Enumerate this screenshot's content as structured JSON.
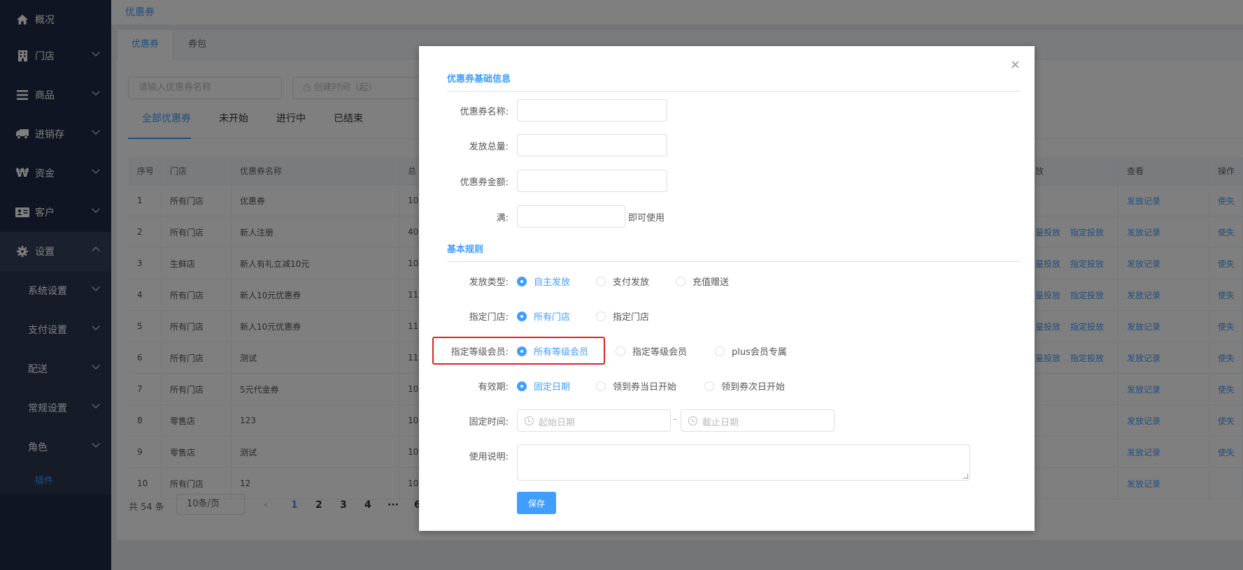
{
  "sidebar": {
    "items": [
      {
        "label": "概况",
        "icon": "home-icon"
      },
      {
        "label": "门店",
        "icon": "building-icon"
      },
      {
        "label": "商品",
        "icon": "list-icon"
      },
      {
        "label": "进销存",
        "icon": "truck-icon"
      },
      {
        "label": "资金",
        "icon": "won-icon"
      },
      {
        "label": "客户",
        "icon": "id-card-icon"
      },
      {
        "label": "设置",
        "icon": "gear-icon"
      }
    ],
    "sub_items": [
      "系统设置",
      "支付设置",
      "配送",
      "常规设置",
      "角色"
    ],
    "sub_sub_item": "插件"
  },
  "topbar": {
    "breadcrumb": "优惠券"
  },
  "background": {
    "tabs": [
      "优惠券",
      "券包"
    ],
    "filters": {
      "name_placeholder": "请输入优惠券名称",
      "date_placeholder": "创建时间（起）"
    },
    "status_tabs": [
      "全部优惠券",
      "未开始",
      "进行中",
      "已结束"
    ],
    "table": {
      "headers": [
        "序号",
        "门店",
        "优惠券名称",
        "总",
        "放",
        "查看",
        "操作"
      ],
      "rows": [
        {
          "no": "1",
          "store": "所有门店",
          "name": "优惠券",
          "total": "10",
          "dist": [
            "",
            ""
          ],
          "view": "发放记录",
          "op": "使失"
        },
        {
          "no": "2",
          "store": "所有门店",
          "name": "新人注册",
          "total": "40",
          "dist": [
            "量投放",
            "指定投放"
          ],
          "view": "发放记录",
          "op": "使失"
        },
        {
          "no": "3",
          "store": "生鲜店",
          "name": "新人有礼立减10元",
          "total": "10",
          "dist": [
            "量投放",
            "指定投放"
          ],
          "view": "发放记录",
          "op": "使失"
        },
        {
          "no": "4",
          "store": "所有门店",
          "name": "新人10元优惠券",
          "total": "11",
          "dist": [
            "量投放",
            "指定投放"
          ],
          "view": "发放记录",
          "op": "使失"
        },
        {
          "no": "5",
          "store": "所有门店",
          "name": "新人10元优惠券",
          "total": "11",
          "dist": [
            "量投放",
            "指定投放"
          ],
          "view": "发放记录",
          "op": "使失"
        },
        {
          "no": "6",
          "store": "所有门店",
          "name": "测试",
          "total": "11",
          "dist": [
            "量投放",
            "指定投放"
          ],
          "view": "发放记录",
          "op": "使失"
        },
        {
          "no": "7",
          "store": "所有门店",
          "name": "5元代金券",
          "total": "10",
          "dist": [
            "",
            ""
          ],
          "view": "发放记录",
          "op": "使失"
        },
        {
          "no": "8",
          "store": "零售店",
          "name": "123",
          "total": "10",
          "dist": [
            "",
            ""
          ],
          "view": "发放记录",
          "op": "使失"
        },
        {
          "no": "9",
          "store": "零售店",
          "name": "测试",
          "total": "10",
          "dist": [
            "",
            ""
          ],
          "view": "发放记录",
          "op": "使失"
        },
        {
          "no": "10",
          "store": "所有门店",
          "name": "12",
          "total": "10",
          "dist": [
            "",
            ""
          ],
          "view": "发放记录",
          "op": ""
        }
      ]
    },
    "pager": {
      "total": "共 54 条",
      "page_size": "10条/页",
      "pages": [
        "1",
        "2",
        "3",
        "4",
        "···",
        "6"
      ],
      "current": "1"
    }
  },
  "modal": {
    "close": "×",
    "section1": "优惠券基础信息",
    "name_label": "优惠券名称:",
    "qty_label": "发放总量:",
    "amount_label": "优惠券金额:",
    "min_label": "满:",
    "min_suffix": "即可使用",
    "section2": "基本规则",
    "issue_type": {
      "label": "发放类型:",
      "options": [
        "自主发放",
        "支付发放",
        "充值赠送"
      ],
      "selected": 0
    },
    "store": {
      "label": "指定门店:",
      "options": [
        "所有门店",
        "指定门店"
      ],
      "selected": 0
    },
    "member": {
      "label": "指定等级会员:",
      "options": [
        "所有等级会员",
        "指定等级会员",
        "plus会员专属"
      ],
      "selected": 0
    },
    "validity": {
      "label": "有效期:",
      "options": [
        "固定日期",
        "领到券当日开始",
        "领到券次日开始"
      ],
      "selected": 0
    },
    "fixed_time": {
      "label": "固定时间:",
      "start_placeholder": "起始日期",
      "separator": "-",
      "end_placeholder": "截止日期"
    },
    "desc_label": "使用说明:",
    "save": "保存"
  },
  "colors": {
    "accent": "#409eff",
    "sidebar": "#1f2a44",
    "highlight": "#e02020"
  }
}
